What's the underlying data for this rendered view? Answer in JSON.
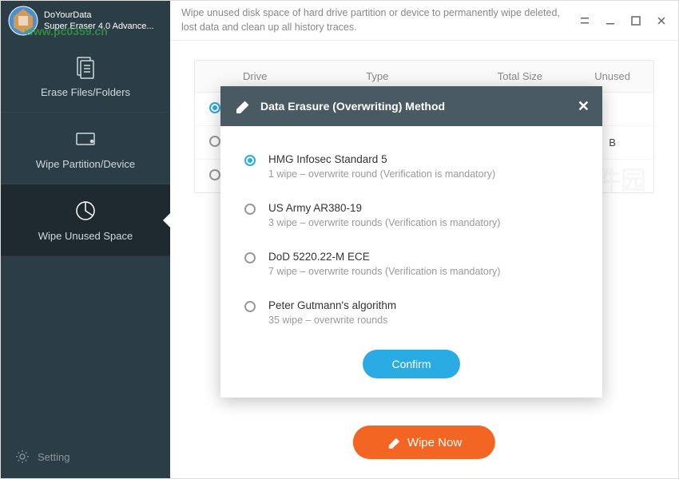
{
  "app": {
    "name": "DoYourData",
    "subtitle": "Super Eraser 4.0 Advance...",
    "watermark": "www.pc0359.cn",
    "watermark_bg": "软件园"
  },
  "sidebar": {
    "items": [
      {
        "label": "Erase Files/Folders"
      },
      {
        "label": "Wipe Partition/Device"
      },
      {
        "label": "Wipe Unused Space"
      }
    ],
    "setting_label": "Setting"
  },
  "header": {
    "description": "Wipe unused disk space of hard drive partition or device to permanently wipe deleted, lost data and clean up all history traces."
  },
  "table": {
    "headers": {
      "drive": "Drive",
      "type": "Type",
      "size": "Total Size",
      "unused": "Unused"
    },
    "rows": [
      {
        "drive": "",
        "type": "",
        "size": "",
        "unused": "",
        "selected": true
      },
      {
        "drive": "",
        "type": "",
        "size": "",
        "unused": "B",
        "selected": false
      },
      {
        "drive": "",
        "type": "",
        "size": "",
        "unused": "",
        "selected": false
      }
    ]
  },
  "wipe_button": "Wipe Now",
  "modal": {
    "title": "Data Erasure (Overwriting) Method",
    "confirm": "Confirm",
    "methods": [
      {
        "name": "HMG Infosec Standard 5",
        "desc": "1 wipe – overwrite round (Verification is mandatory)",
        "selected": true
      },
      {
        "name": "US Army AR380-19",
        "desc": "3 wipe – overwrite rounds (Verification is mandatory)",
        "selected": false
      },
      {
        "name": "DoD 5220.22-M ECE",
        "desc": "7 wipe – overwrite rounds (Verification is mandatory)",
        "selected": false
      },
      {
        "name": "Peter Gutmann's algorithm",
        "desc": "35 wipe – overwrite rounds",
        "selected": false
      }
    ]
  }
}
